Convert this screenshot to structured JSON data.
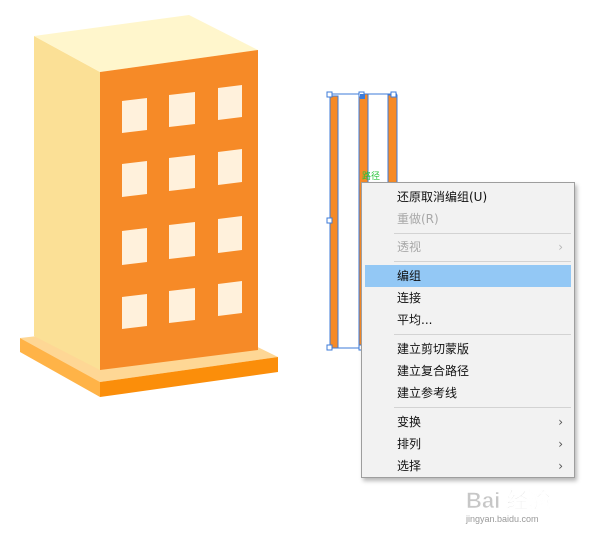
{
  "artboard": {
    "hint_label": "路径",
    "colors": {
      "building_front": "#f68a27",
      "building_side": "#fbe096",
      "building_top": "#fff6cc",
      "window": "#fff1dc",
      "base_light": "#fed795",
      "base_dark": "#fb8e0a",
      "selection": "#3d7bd8"
    }
  },
  "context_menu": {
    "items": [
      {
        "label": "还原取消编组(U)",
        "disabled": false,
        "submenu": false
      },
      {
        "label": "重做(R)",
        "disabled": true,
        "submenu": false
      },
      {
        "label": "透视",
        "disabled": true,
        "submenu": true
      },
      {
        "label": "编组",
        "disabled": false,
        "submenu": false,
        "highlighted": true
      },
      {
        "label": "连接",
        "disabled": false,
        "submenu": false
      },
      {
        "label": "平均...",
        "disabled": false,
        "submenu": false
      },
      {
        "label": "建立剪切蒙版",
        "disabled": false,
        "submenu": false
      },
      {
        "label": "建立复合路径",
        "disabled": false,
        "submenu": false
      },
      {
        "label": "建立参考线",
        "disabled": false,
        "submenu": false
      },
      {
        "label": "变换",
        "disabled": false,
        "submenu": true
      },
      {
        "label": "排列",
        "disabled": false,
        "submenu": true
      },
      {
        "label": "选择",
        "disabled": false,
        "submenu": true
      }
    ],
    "submenu_arrow": "›"
  },
  "watermark": {
    "logo_text": "Bai 经验",
    "url": "jingyan.baidu.com"
  }
}
